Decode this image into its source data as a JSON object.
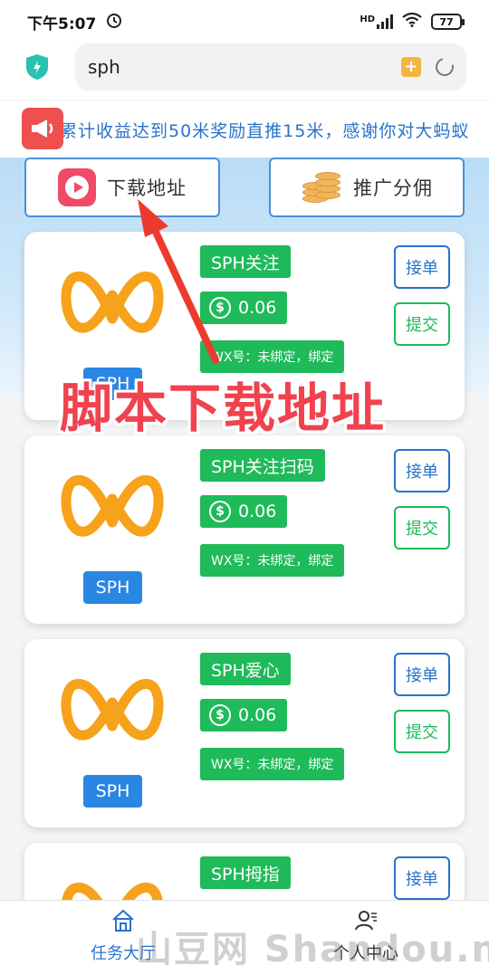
{
  "status_bar": {
    "time": "下午5:07",
    "battery": "77",
    "network": "HD"
  },
  "browser": {
    "url": "sph"
  },
  "marquee": {
    "text": "累计收益达到50米奖励直推15米，感谢你对大蚂蚁"
  },
  "top_buttons": {
    "download": "下载地址",
    "promotion": "推广分佣"
  },
  "annotation": {
    "label": "脚本下载地址"
  },
  "tasks": [
    {
      "title": "SPH关注",
      "price": "0.06",
      "wx": "WX号：未绑定，绑定",
      "badge": "SPH",
      "accept": "接单",
      "submit": "提交"
    },
    {
      "title": "SPH关注扫码",
      "price": "0.06",
      "wx": "WX号：未绑定，绑定",
      "badge": "SPH",
      "accept": "接单",
      "submit": "提交"
    },
    {
      "title": "SPH爱心",
      "price": "0.06",
      "wx": "WX号：未绑定，绑定",
      "badge": "SPH",
      "accept": "接单",
      "submit": "提交"
    },
    {
      "title": "SPH拇指",
      "accept": "接单"
    }
  ],
  "bottom_nav": {
    "home": "任务大厅",
    "me": "个人中心"
  },
  "watermark": "山豆网 Shandou.net",
  "colors": {
    "accent_blue": "#2a73c9",
    "green": "#1fba5a",
    "red": "#f0424f",
    "orange": "#f7a21b"
  }
}
